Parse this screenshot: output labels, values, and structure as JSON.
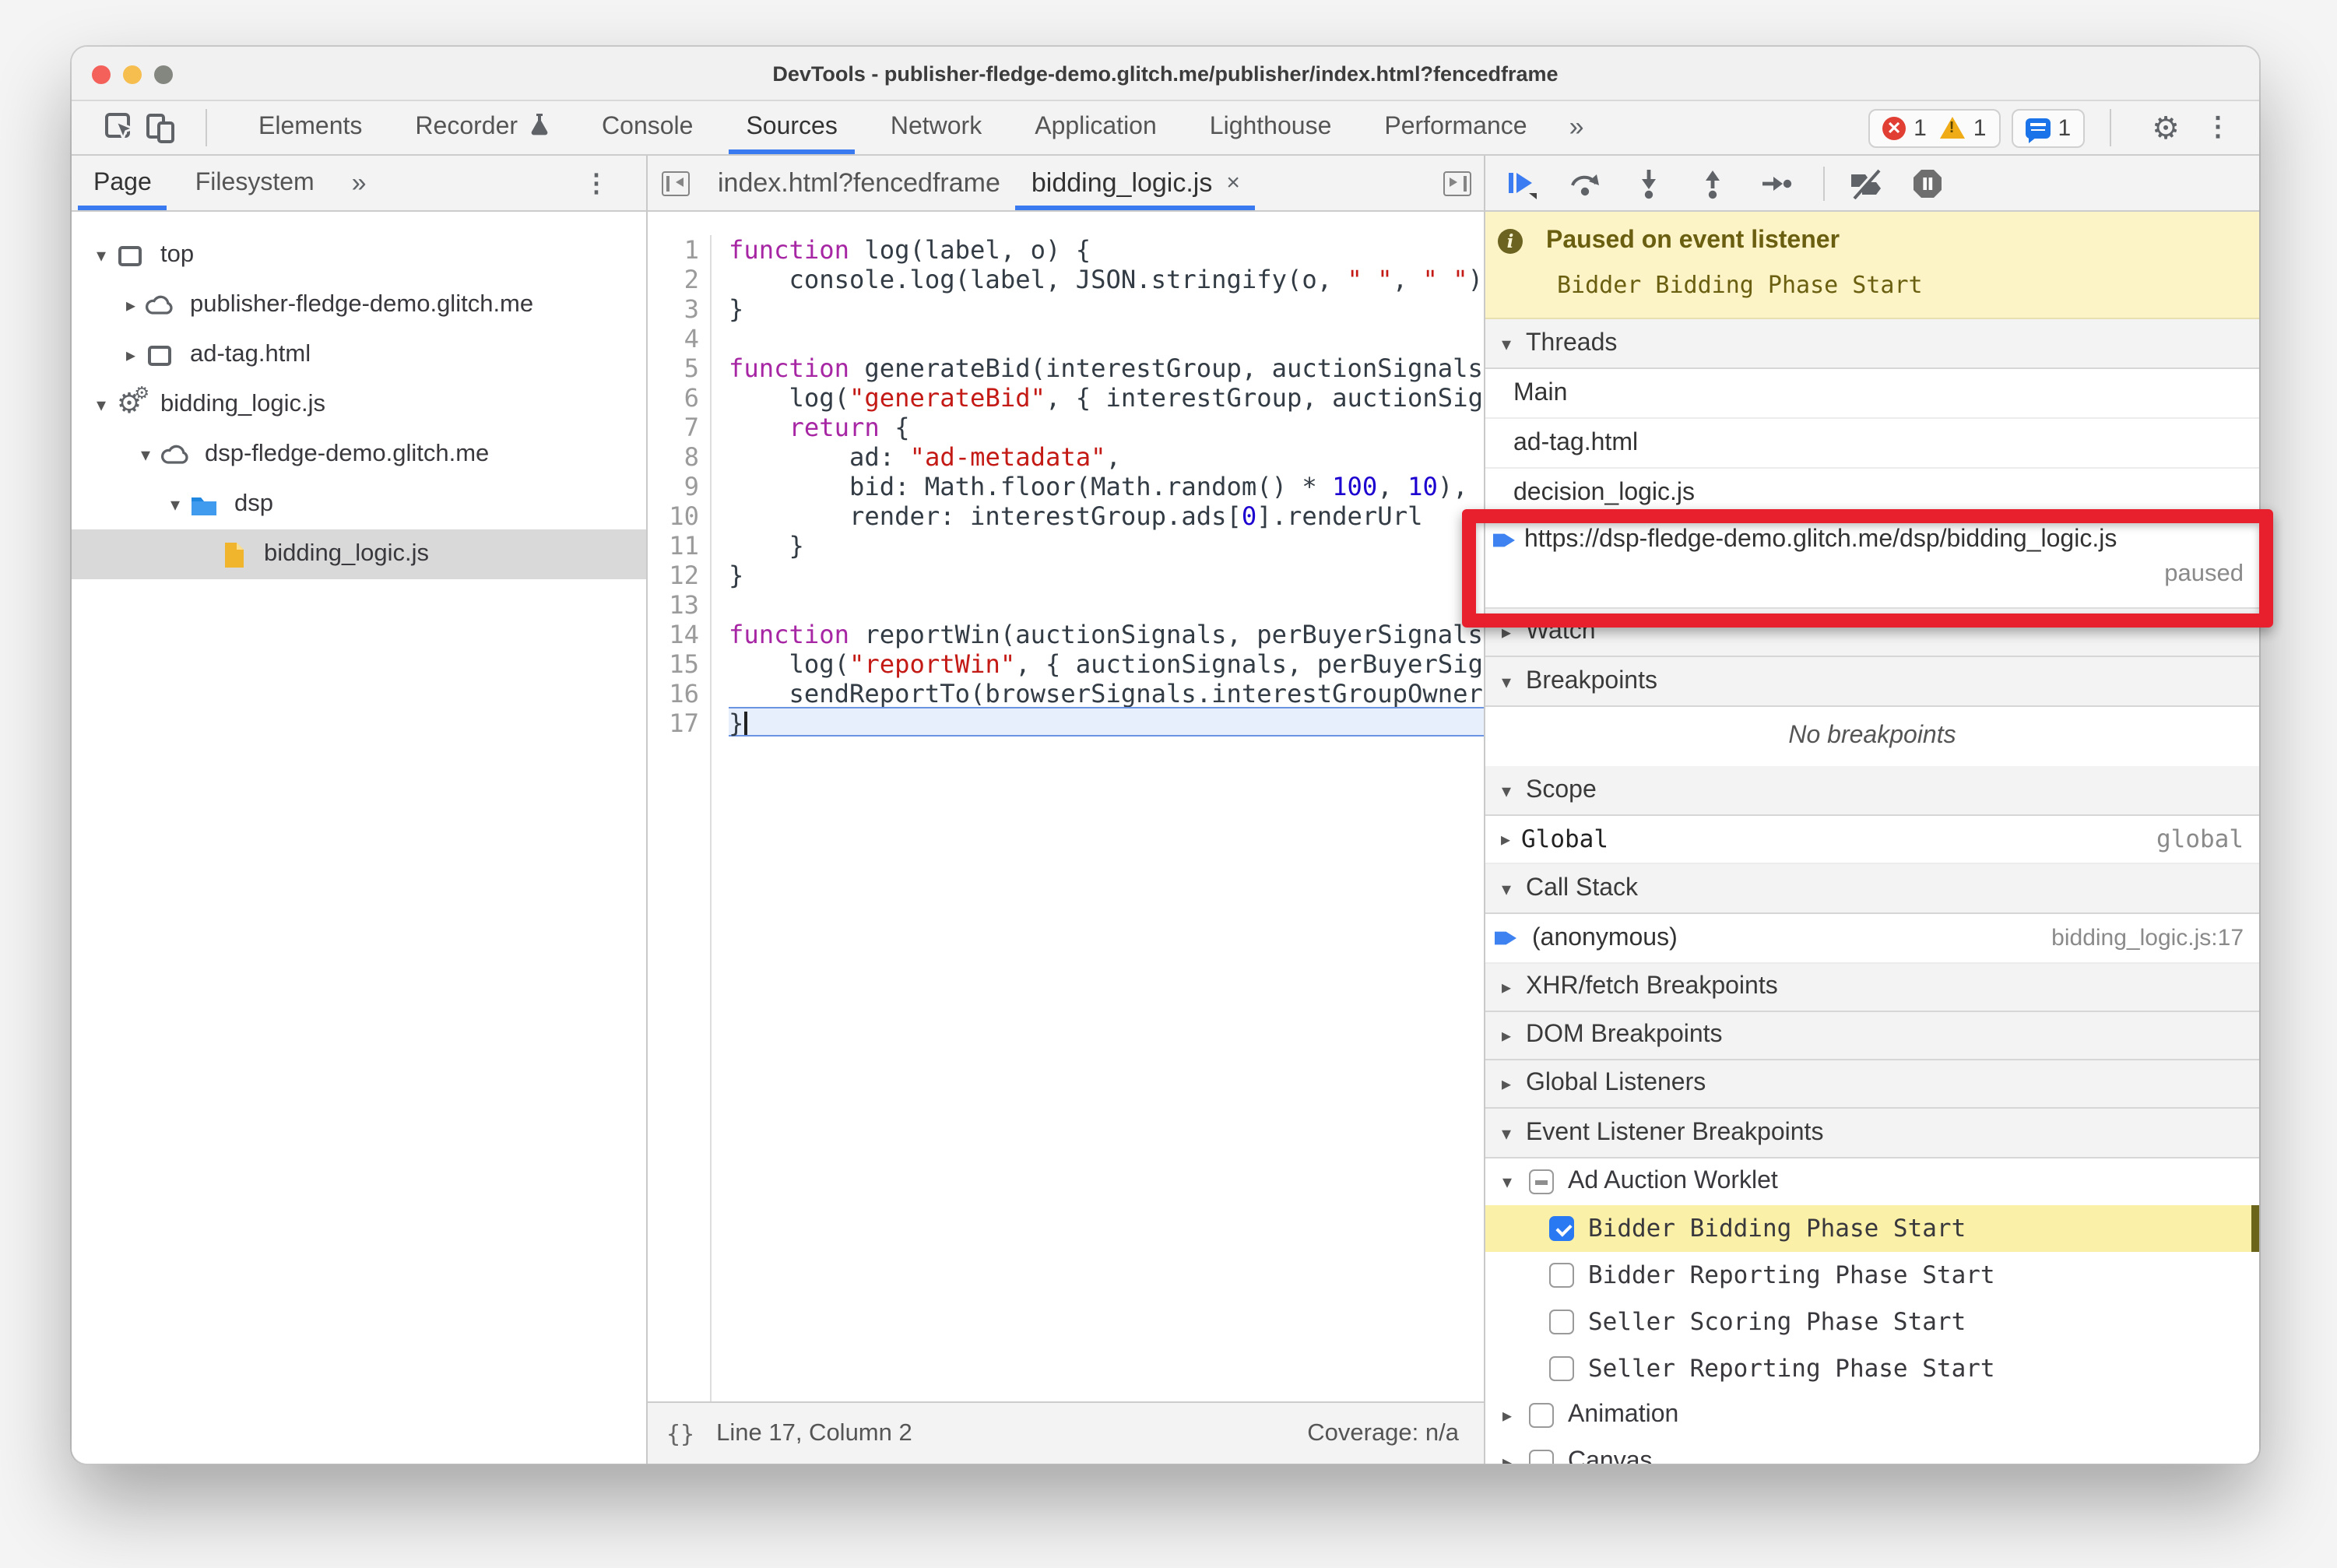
{
  "window": {
    "title": "DevTools - publisher-fledge-demo.glitch.me/publisher/index.html?fencedframe"
  },
  "main_tabs": {
    "items": [
      "Elements",
      "Recorder",
      "Console",
      "Sources",
      "Network",
      "Application",
      "Lighthouse",
      "Performance"
    ],
    "selected": "Sources",
    "overflow": "»"
  },
  "badges": {
    "error_count": "1",
    "warning_count": "1",
    "issue_count": "1"
  },
  "sidebar": {
    "tabs": [
      "Page",
      "Filesystem"
    ],
    "selected": "Page",
    "overflow": "»",
    "tree": [
      {
        "label": "top",
        "icon": "frame",
        "depth": 0,
        "arrow": "expanded"
      },
      {
        "label": "publisher-fledge-demo.glitch.me",
        "icon": "cloud",
        "depth": 1,
        "arrow": "collapsed"
      },
      {
        "label": "ad-tag.html",
        "icon": "frame",
        "depth": 1,
        "arrow": "collapsed"
      },
      {
        "label": "bidding_logic.js",
        "icon": "worklet",
        "depth": 0,
        "arrow": "expanded"
      },
      {
        "label": "dsp-fledge-demo.glitch.me",
        "icon": "cloud",
        "depth": 1.5,
        "arrow": "expanded"
      },
      {
        "label": "dsp",
        "icon": "folder",
        "depth": 2.5,
        "arrow": "expanded"
      },
      {
        "label": "bidding_logic.js",
        "icon": "file",
        "depth": 3.5,
        "arrow": "none",
        "selected": true
      }
    ]
  },
  "editor": {
    "tabs": [
      {
        "label": "index.html?fencedframe",
        "active": false
      },
      {
        "label": "bidding_logic.js",
        "active": true,
        "close": "×"
      }
    ],
    "lines": [
      [
        [
          "kw",
          "function"
        ],
        [
          "pl",
          " log(label, o) {"
        ]
      ],
      [
        [
          "pl",
          "    console.log(label, JSON.stringify(o, "
        ],
        [
          "str",
          "\" \""
        ],
        [
          "pl",
          ", "
        ],
        [
          "str",
          "\" \""
        ],
        [
          "pl",
          "));"
        ]
      ],
      [
        [
          "pl",
          "}"
        ]
      ],
      [],
      [
        [
          "kw",
          "function"
        ],
        [
          "pl",
          " generateBid(interestGroup, auctionSignals, perBuyerSignals, trustedBiddingSignals, browserSignals) {"
        ]
      ],
      [
        [
          "pl",
          "    log("
        ],
        [
          "str",
          "\"generateBid\""
        ],
        [
          "pl",
          ", { interestGroup, auctionSignals, perBuyerSignals });"
        ]
      ],
      [
        [
          "pl",
          "    "
        ],
        [
          "kw",
          "return"
        ],
        [
          "pl",
          " {"
        ]
      ],
      [
        [
          "pl",
          "        ad: "
        ],
        [
          "str",
          "\"ad-metadata\""
        ],
        [
          "pl",
          ","
        ]
      ],
      [
        [
          "pl",
          "        bid: Math.floor(Math.random() * "
        ],
        [
          "num",
          "100"
        ],
        [
          "pl",
          ", "
        ],
        [
          "num",
          "10"
        ],
        [
          "pl",
          "),"
        ]
      ],
      [
        [
          "pl",
          "        render: interestGroup.ads["
        ],
        [
          "num",
          "0"
        ],
        [
          "pl",
          "].renderUrl"
        ]
      ],
      [
        [
          "pl",
          "    }"
        ]
      ],
      [
        [
          "pl",
          "}"
        ]
      ],
      [],
      [
        [
          "kw",
          "function"
        ],
        [
          "pl",
          " reportWin(auctionSignals, perBuyerSignals, sellerSignals, browserSignals) {"
        ]
      ],
      [
        [
          "pl",
          "    log("
        ],
        [
          "str",
          "\"reportWin\""
        ],
        [
          "pl",
          ", { auctionSignals, perBuyerSignals, sellerSignals });"
        ]
      ],
      [
        [
          "pl",
          "    sendReportTo(browserSignals.interestGroupOwner);"
        ]
      ],
      [
        [
          "pl",
          "}"
        ]
      ]
    ],
    "active_line": 17,
    "status": {
      "brackets": "{}",
      "position": "Line 17, Column 2",
      "coverage": "Coverage: n/a"
    }
  },
  "debugger": {
    "banner": {
      "title": "Paused on event listener",
      "subtitle": "Bidder Bidding Phase Start"
    },
    "threads": {
      "label": "Threads",
      "items": [
        "Main",
        "ad-tag.html",
        "decision_logic.js"
      ],
      "paused_thread": {
        "url": "https://dsp-fledge-demo.glitch.me/dsp/bidding_logic.js",
        "status": "paused"
      }
    },
    "sections": {
      "watch": "Watch",
      "breakpoints": "Breakpoints",
      "breakpoints_empty": "No breakpoints",
      "scope": "Scope",
      "scope_row": {
        "name": "Global",
        "value": "global"
      },
      "call_stack": "Call Stack",
      "stack_row": {
        "name": "(anonymous)",
        "location": "bidding_logic.js:17"
      },
      "xhr": "XHR/fetch Breakpoints",
      "dom": "DOM Breakpoints",
      "global_listeners": "Global Listeners",
      "event_listener_breakpoints": "Event Listener Breakpoints"
    },
    "event_tree": [
      {
        "label": "Ad Auction Worklet",
        "type": "group",
        "checkbox": "indeterminate",
        "arrow": "expanded"
      },
      {
        "label": "Bidder Bidding Phase Start",
        "type": "leaf",
        "checkbox": "checked",
        "highlighted": true
      },
      {
        "label": "Bidder Reporting Phase Start",
        "type": "leaf",
        "checkbox": "unchecked"
      },
      {
        "label": "Seller Scoring Phase Start",
        "type": "leaf",
        "checkbox": "unchecked"
      },
      {
        "label": "Seller Reporting Phase Start",
        "type": "leaf",
        "checkbox": "unchecked"
      },
      {
        "label": "Animation",
        "type": "group",
        "checkbox": "unchecked",
        "arrow": "collapsed"
      },
      {
        "label": "Canvas",
        "type": "group",
        "checkbox": "unchecked",
        "arrow": "collapsed"
      }
    ]
  },
  "colors": {
    "accent_blue": "#3a7af0",
    "annotation_red": "#e8202e",
    "banner_yellow": "#fcf3c6",
    "highlight_yellow": "#fbf0a8"
  }
}
